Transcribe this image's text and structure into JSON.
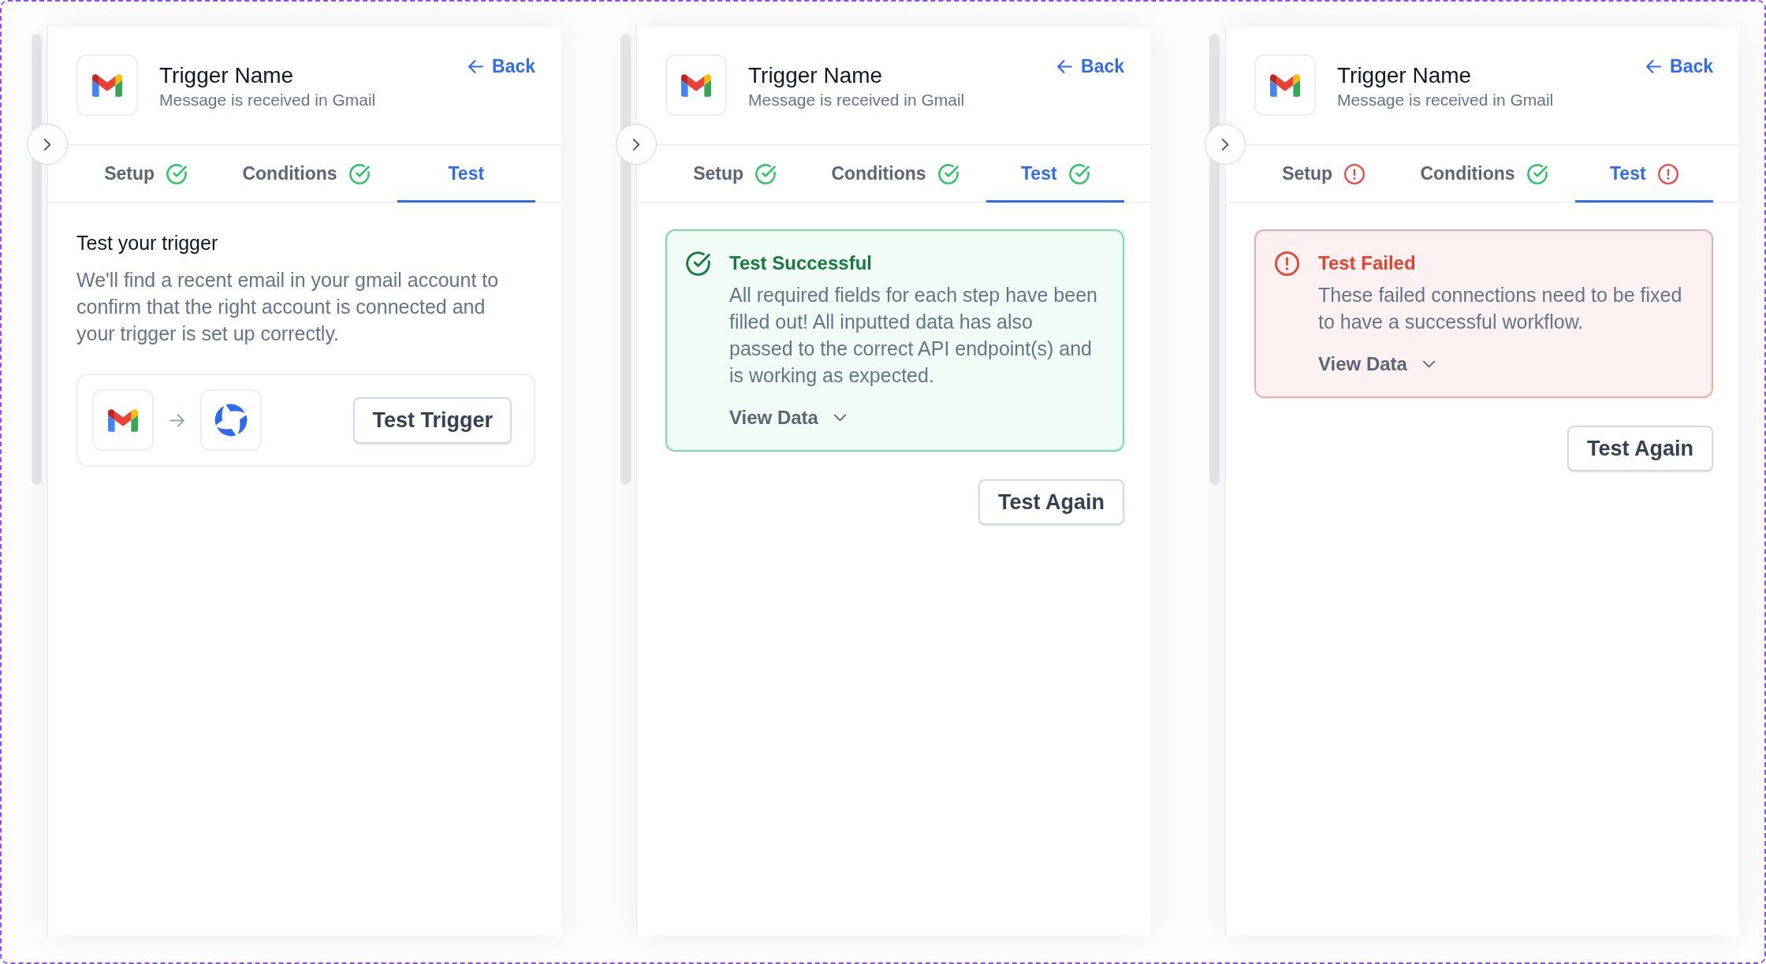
{
  "panels": [
    {
      "header": {
        "title": "Trigger Name",
        "subtitle": "Message is received in Gmail",
        "back": "Back"
      },
      "tabs": [
        {
          "label": "Setup",
          "selected": false,
          "kind": "done"
        },
        {
          "label": "Conditions",
          "selected": false,
          "kind": "done"
        },
        {
          "label": "Test",
          "selected": true,
          "kind": "plain"
        }
      ],
      "body": {
        "kind": "intro",
        "heading": "Test your trigger",
        "text": "We'll find a recent email in your gmail account to confirm that the right account is connected and your trigger is set up correctly.",
        "button": "Test Trigger"
      }
    },
    {
      "header": {
        "title": "Trigger Name",
        "subtitle": "Message is received in Gmail",
        "back": "Back"
      },
      "tabs": [
        {
          "label": "Setup",
          "selected": false,
          "kind": "done"
        },
        {
          "label": "Conditions",
          "selected": false,
          "kind": "done"
        },
        {
          "label": "Test",
          "selected": true,
          "kind": "done"
        }
      ],
      "body": {
        "kind": "success",
        "title": "Test Successful",
        "text": "All required fields for each step have been filled out! All inputted data has also passed to the correct API endpoint(s) and is working as expected.",
        "link": "View Data",
        "button": "Test Again"
      }
    },
    {
      "header": {
        "title": "Trigger Name",
        "subtitle": "Message is received in Gmail",
        "back": "Back"
      },
      "tabs": [
        {
          "label": "Setup",
          "selected": false,
          "kind": "error"
        },
        {
          "label": "Conditions",
          "selected": false,
          "kind": "done"
        },
        {
          "label": "Test",
          "selected": true,
          "kind": "error"
        }
      ],
      "body": {
        "kind": "failure",
        "title": "Test Failed",
        "text": "These failed connections need to be fixed to have a successful workflow.",
        "link": "View Data",
        "button": "Test Again"
      }
    }
  ]
}
